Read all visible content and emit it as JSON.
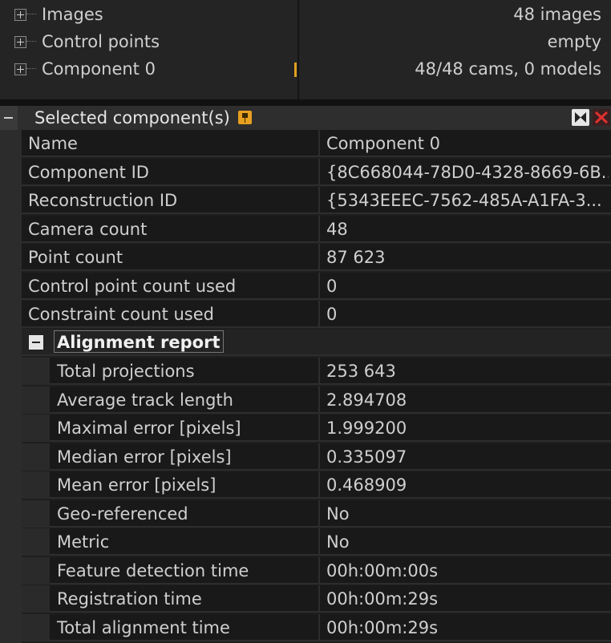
{
  "tree": {
    "items": [
      {
        "label": "Images",
        "value": "48 images"
      },
      {
        "label": "Control points",
        "value": "empty"
      },
      {
        "label": "Component 0",
        "value": "48/48 cams, 0 models"
      }
    ]
  },
  "panel": {
    "title": "Selected component(s)"
  },
  "properties": [
    {
      "name": "Name",
      "value": "Component 0"
    },
    {
      "name": "Component ID",
      "value": "{8C668044-78D0-4328-8669-6B..."
    },
    {
      "name": "Reconstruction ID",
      "value": "{5343EEEC-7562-485A-A1FA-3..."
    },
    {
      "name": "Camera count",
      "value": "48"
    },
    {
      "name": "Point count",
      "value": "87 623"
    },
    {
      "name": "Control point count used",
      "value": "0"
    },
    {
      "name": "Constraint count used",
      "value": "0"
    }
  ],
  "alignment_report": {
    "title": "Alignment report",
    "rows": [
      {
        "name": "Total projections",
        "value": "253 643"
      },
      {
        "name": "Average track length",
        "value": "2.894708"
      },
      {
        "name": "Maximal error [pixels]",
        "value": "1.999200"
      },
      {
        "name": "Median error [pixels]",
        "value": "0.335097"
      },
      {
        "name": "Mean error [pixels]",
        "value": "0.468909"
      },
      {
        "name": "Geo-referenced",
        "value": "No"
      },
      {
        "name": "Metric",
        "value": "No"
      },
      {
        "name": "Feature detection time",
        "value": "00h:00m:00s"
      },
      {
        "name": "Registration time",
        "value": "00h:00m:29s"
      },
      {
        "name": "Total alignment time",
        "value": "00h:00m:29s"
      }
    ]
  }
}
